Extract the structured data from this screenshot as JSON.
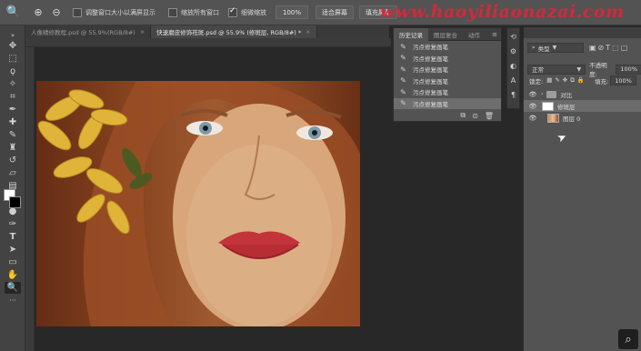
{
  "options_bar": {
    "resize_windows_label": "调整窗口大小以满屏显示",
    "zoom_all_windows_label": "缩放所有窗口",
    "scrubby_zoom_label": "细微缩放",
    "zoom_value": "100%",
    "fit_screen_label": "适合屏幕",
    "fill_screen_label": "填充屏幕",
    "resize_windows_checked": false,
    "zoom_all_windows_checked": false,
    "scrubby_zoom_checked": true
  },
  "watermark": "www.haoyiliaonazai.com",
  "tabs": [
    {
      "label": "人像精修教程.psd @ 55.9%(RGB/8#)",
      "active": false
    },
    {
      "label": "快速磨皮修饰祛斑.psd @ 55.9% (修斑层, RGB/8#) *",
      "active": true
    }
  ],
  "history_panel": {
    "tabs": [
      "历史记录",
      "图层复合",
      "动作"
    ],
    "items": [
      "污点修复画笔",
      "污点修复画笔",
      "污点修复画笔",
      "污点修复画笔",
      "污点修复画笔",
      "污点修复画笔"
    ],
    "active_index": 5
  },
  "layers_panel": {
    "filter_kind": "类型",
    "blend_mode": "正常",
    "opacity_label": "不透明度:",
    "opacity_value": "100%",
    "lock_label": "锁定:",
    "fill_label": "填充:",
    "fill_value": "100%",
    "layers": [
      {
        "name": "对比",
        "type": "group",
        "selected": false
      },
      {
        "name": "修斑层",
        "type": "layer",
        "selected": true
      },
      {
        "name": "图层 0",
        "type": "layer",
        "selected": false
      }
    ]
  },
  "colors": {
    "foreground": "#ffffff",
    "background": "#000000",
    "watermark": "#d22a3a",
    "panel": "#535353"
  },
  "icons": [
    "zoom-in-icon",
    "zoom-out-icon",
    "hand-icon",
    "eye-icon",
    "folder-icon",
    "brush-icon"
  ]
}
